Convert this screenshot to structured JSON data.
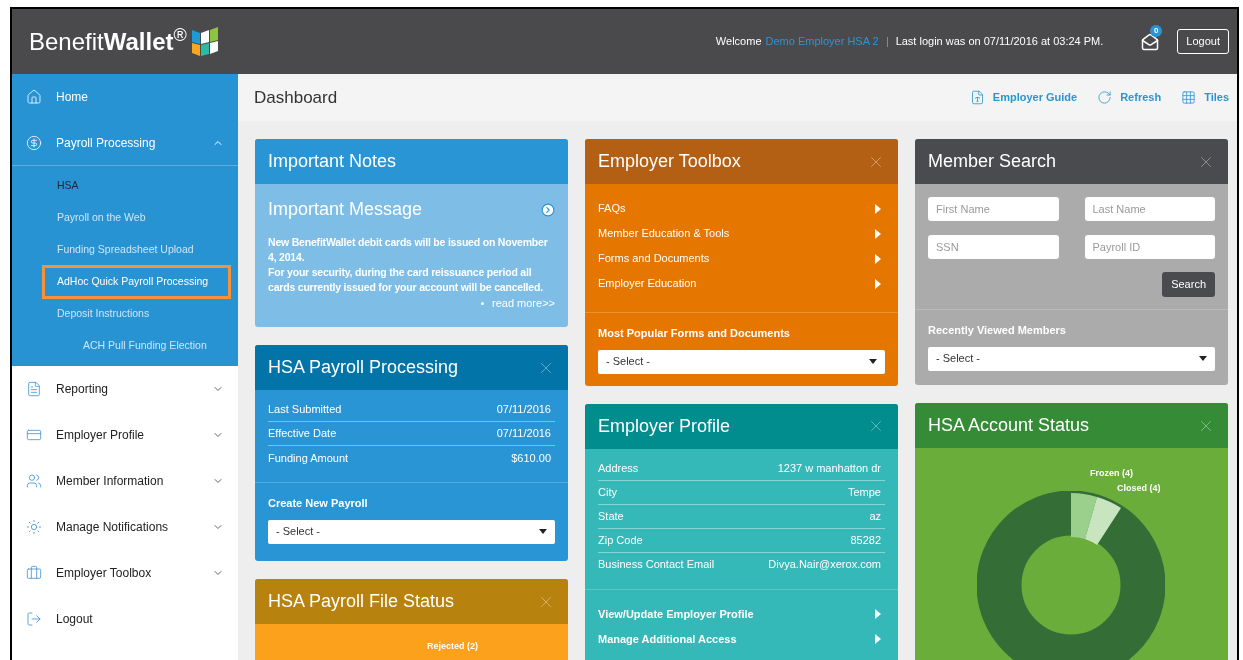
{
  "header": {
    "logo": "Benefit**Wallet**$^{®}$",
    "welcome": "Welcome",
    "user": "Demo Employer HSA 2",
    "last_login": "Last login was on 07/11/2016 at 03:24 PM.",
    "mail_count": "0",
    "logout": "Logout"
  },
  "sidebar": {
    "items": [
      {
        "label": "Home",
        "expanded": false,
        "has_menu": false
      },
      {
        "label": "Payroll Processing",
        "expanded": true,
        "has_menu": true,
        "children": [
          {
            "label": "HSA",
            "selected": true,
            "highlighted": false
          },
          {
            "label": "Payroll on the Web",
            "selected": false,
            "highlighted": false
          },
          {
            "label": "Funding Spreadsheet Upload",
            "selected": false,
            "highlighted": false
          },
          {
            "label": "AdHoc Quick Payroll Processing",
            "selected": false,
            "highlighted": true
          },
          {
            "label": "Deposit Instructions",
            "selected": false,
            "highlighted": false,
            "children": [
              {
                "label": "ACH Pull Funding Election",
                "selected": false,
                "highlighted": false
              }
            ]
          }
        ]
      },
      {
        "label": "Reporting",
        "expanded": false,
        "has_menu": true
      },
      {
        "label": "Employer Profile",
        "expanded": false,
        "has_menu": true
      },
      {
        "label": "Member Information",
        "expanded": false,
        "has_menu": true
      },
      {
        "label": "Manage Notifications",
        "expanded": false,
        "has_menu": true
      },
      {
        "label": "Employer Toolbox",
        "expanded": false,
        "has_menu": true
      },
      {
        "label": "Logout",
        "expanded": false,
        "has_menu": false
      }
    ]
  },
  "page": {
    "title": "Dashboard",
    "actions": [
      "Employer Guide",
      "Refresh",
      "Tiles"
    ]
  },
  "columns": [
    [
      {
        "kind": "notes",
        "title": "Important Notes",
        "closable": false,
        "message_title": "Important Message",
        "message": [
          "New BenefitWallet debit cards will be issued on November 4, 2014.",
          "For your security, during the card reissuance period all cards currently issued for your account will be cancelled."
        ],
        "link": "read more>>"
      },
      {
        "kind": "summary",
        "title": "HSA Payroll Processing",
        "closable": true,
        "rows": [
          {
            "label": "Last Submitted",
            "value": "07/11/2016"
          },
          {
            "label": "Effective Date",
            "value": "07/11/2016"
          },
          {
            "label": "Funding Amount",
            "value": "$610.00"
          }
        ],
        "select_label": "Create New Payroll",
        "select_value": "- Select -"
      },
      {
        "kind": "pie",
        "title": "HSA Payroll File Status",
        "closable": true,
        "labels": [
          "Rejected (2)"
        ]
      }
    ],
    [
      {
        "kind": "links",
        "title": "Employer Toolbox",
        "closable": true,
        "links": [
          "FAQs",
          "Member Education & Tools",
          "Forms and Documents",
          "Employer Education"
        ],
        "select_label": "Most Popular Forms and Documents",
        "select_value": "- Select -"
      },
      {
        "kind": "profile",
        "title": "Employer Profile",
        "closable": true,
        "rows": [
          {
            "label": "Address",
            "value": "1237 w manhatton dr"
          },
          {
            "label": "City",
            "value": "Tempe"
          },
          {
            "label": "State",
            "value": "az"
          },
          {
            "label": "Zip Code",
            "value": "85282"
          },
          {
            "label": "Business Contact Email",
            "value": "Divya.Nair@xerox.com"
          }
        ],
        "links": [
          "View/Update Employer Profile",
          "Manage Additional Access"
        ]
      }
    ],
    [
      {
        "kind": "search",
        "title": "Member Search",
        "closable": true,
        "placeholders": [
          "First Name",
          "Last Name",
          "SSN",
          "Payroll ID"
        ],
        "button": "Search",
        "select_label": "Recently Viewed Members",
        "select_value": "- Select -"
      },
      {
        "kind": "pie",
        "title": "HSA Account Status",
        "closable": true,
        "labels": [
          "Frozen (4)",
          "Closed (4)"
        ]
      }
    ]
  ]
}
